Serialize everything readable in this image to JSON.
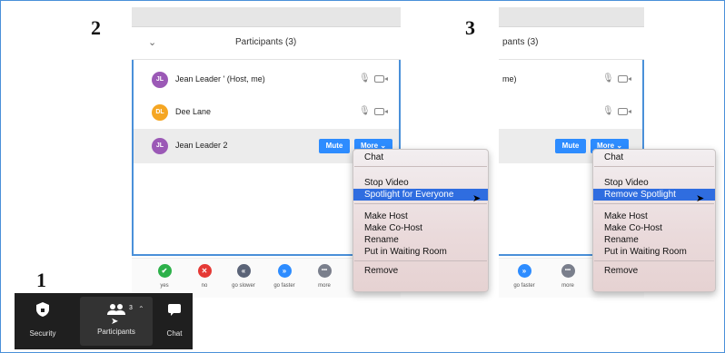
{
  "steps": {
    "one": "1",
    "two": "2",
    "three": "3"
  },
  "panel_left": {
    "title": "Participants (3)",
    "participants": [
      {
        "initials": "JL",
        "name": "Jean Leader ' (Host, me)",
        "color": "#9b59b6"
      },
      {
        "initials": "DL",
        "name": "Dee Lane",
        "color": "#f5a623"
      },
      {
        "initials": "JL",
        "name": "Jean Leader  2",
        "color": "#9b59b6"
      }
    ],
    "mute_label": "Mute",
    "more_label": "More",
    "reactions": [
      {
        "label": "yes",
        "icon": "✔",
        "color": "#2db14a",
        "icon_name": "check-icon"
      },
      {
        "label": "no",
        "icon": "✕",
        "color": "#e53935",
        "icon_name": "x-icon"
      },
      {
        "label": "go slower",
        "icon": "«",
        "color": "#5b6478",
        "icon_name": "rewind-icon"
      },
      {
        "label": "go faster",
        "icon": "»",
        "color": "#2d8cff",
        "icon_name": "fast-forward-icon"
      },
      {
        "label": "more",
        "icon": "•••",
        "color": "#7a7f8c",
        "icon_name": "ellipsis-icon"
      }
    ],
    "menu": {
      "chat": "Chat",
      "stop_video": "Stop Video",
      "spotlight": "Spotlight for Everyone",
      "make_host": "Make Host",
      "make_cohost": "Make Co-Host",
      "rename": "Rename",
      "waiting_room": "Put in Waiting Room",
      "remove": "Remove"
    }
  },
  "panel_right": {
    "title_fragment": "pants (3)",
    "row1_fragment": "me)",
    "mute_label": "Mute",
    "more_label": "More",
    "reactions": [
      {
        "label": "go faster",
        "icon": "»",
        "color": "#2d8cff",
        "icon_name": "fast-forward-icon"
      },
      {
        "label": "more",
        "icon": "•••",
        "color": "#7a7f8c",
        "icon_name": "ellipsis-icon"
      }
    ],
    "menu": {
      "chat": "Chat",
      "stop_video": "Stop Video",
      "spotlight": "Remove Spotlight",
      "make_host": "Make Host",
      "make_cohost": "Make Co-Host",
      "rename": "Rename",
      "waiting_room": "Put in Waiting Room",
      "remove": "Remove"
    }
  },
  "toolbar": {
    "security": "Security",
    "participants": "Participants",
    "participants_count": "3",
    "chat": "Chat"
  }
}
